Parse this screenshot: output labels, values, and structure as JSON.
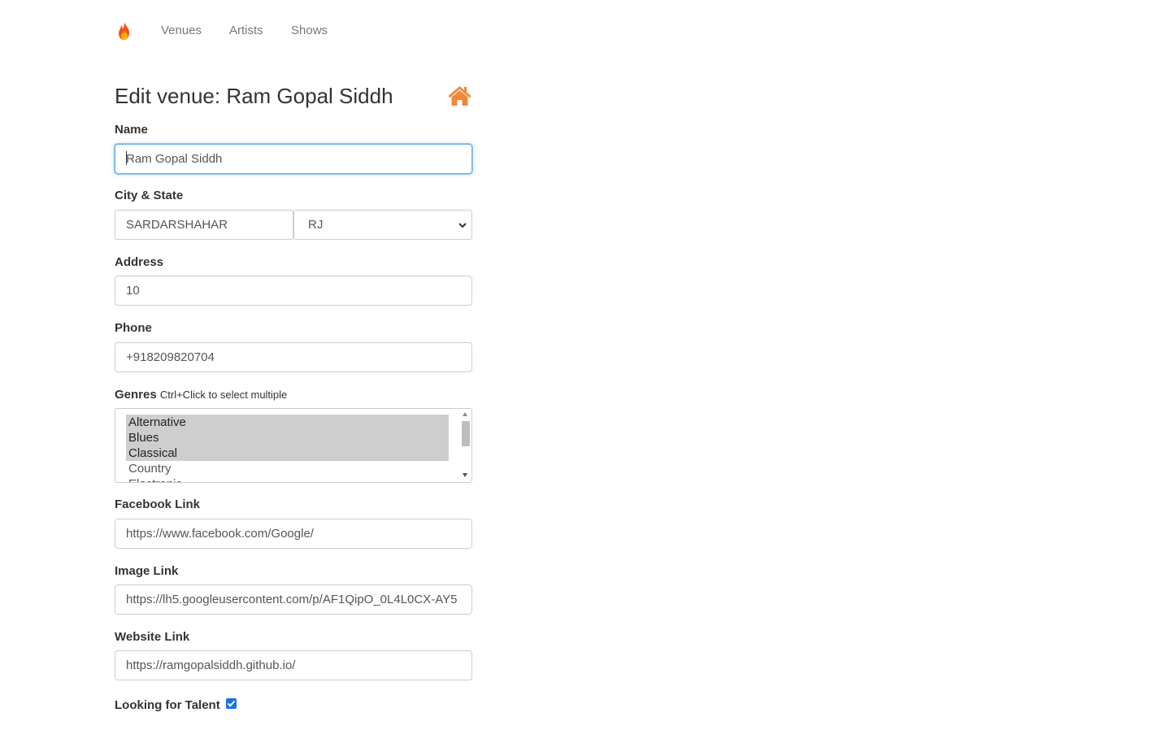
{
  "nav": {
    "brand_icon": "fire-icon",
    "links": [
      "Venues",
      "Artists",
      "Shows"
    ]
  },
  "page": {
    "title": "Edit venue: Ram Gopal Siddh",
    "home_icon": "home-icon",
    "accent_color": "#f0883a"
  },
  "form": {
    "name": {
      "label": "Name",
      "value": "Ram Gopal Siddh"
    },
    "city_state": {
      "label": "City & State",
      "city": "SARDARSHAHAR",
      "state": "RJ"
    },
    "address": {
      "label": "Address",
      "value": "10"
    },
    "phone": {
      "label": "Phone",
      "value": "+918209820704"
    },
    "genres": {
      "label": "Genres",
      "hint": "Ctrl+Click to select multiple",
      "options": [
        {
          "label": "Alternative",
          "selected": true
        },
        {
          "label": "Blues",
          "selected": true
        },
        {
          "label": "Classical",
          "selected": true
        },
        {
          "label": "Country",
          "selected": false
        },
        {
          "label": "Electronic",
          "selected": false
        }
      ]
    },
    "facebook": {
      "label": "Facebook Link",
      "value": "https://www.facebook.com/Google/"
    },
    "image": {
      "label": "Image Link",
      "value": "https://lh5.googleusercontent.com/p/AF1QipO_0L4L0CX-AY5"
    },
    "website": {
      "label": "Website Link",
      "value": "https://ramgopalsiddh.github.io/"
    },
    "seeking_talent": {
      "label": "Looking for Talent",
      "checked": true
    }
  }
}
